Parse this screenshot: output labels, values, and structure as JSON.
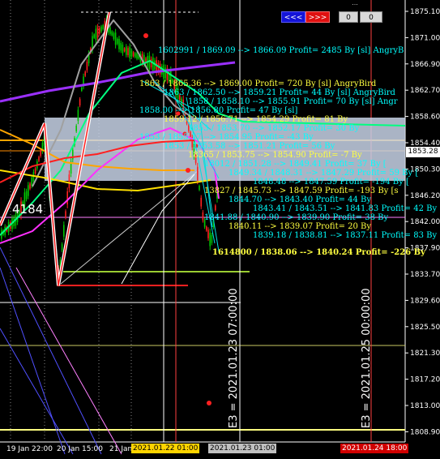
{
  "window": {
    "title": "..."
  },
  "controls": {
    "prev": "<<<",
    "next": ">>>",
    "field_a": "0",
    "field_b": "0"
  },
  "price_axis": {
    "labels": [
      "1875.10",
      "1871.00",
      "1866.90",
      "1862.70",
      "1858.60",
      "1854.40",
      "1850.30",
      "1846.20",
      "1842.00",
      "1837.90",
      "1833.70",
      "1829.60",
      "1825.50",
      "1821.30",
      "1817.20",
      "1813.00",
      "1808.90"
    ],
    "current_price": "1853.28"
  },
  "time_axis": {
    "labels": [
      "19 Jan 22:00",
      "20 Jan 15:00",
      "21 Jan"
    ],
    "highlighted": [
      {
        "text": "2021.01.22 01:00",
        "color": "#ffd400"
      },
      {
        "text": "2021.01.23 01:00",
        "color": "#c0c0c0"
      },
      {
        "text": "2021.01.24 18:00",
        "color": "#d00000"
      }
    ]
  },
  "vertical_markers": [
    {
      "text": "E3 = 2021.01.23 07:00:00"
    },
    {
      "text": "E3 = 2021.01.25 00:00:00"
    }
  ],
  "annotations": {
    "top_trade": "1602991 / 1869.09 --> 1866.09 Profit= 2485 By [sl] AngryB",
    "bottom_trade": "1614800 / 1838.06 --> 1840.24 Profit= -226 By",
    "left_label": "4184",
    "overlap_lines": [
      "1863 / 1865.36 --> 1869.00 Profit= 720 By [sl] AngryBird",
      "1863 / 1862.50 --> 1859.21 Profit= 44 By [sl] AngryBird",
      "1858 / 1858.10 --> 1855.91 Profit= 70 By [sl] Angr",
      "1858.00 --> 1856.80 Profit= 47 By [sl]",
      "1859.12 / 1856.71 --> 1854.29 Profit= 81 By",
      "1853 / 1853.70 --> 1852.17 Profit= 30 By",
      "1853 / 1855.17 --> 1854.95 Profit= -43 By",
      "1853 / 1853.58 --> 1851.21 Profit= 56 By",
      "18365 / 1853.75 --> 1854.90 Profit= -7 By",
      "18012 / 1851.28 --> 1849.41 Profit= 37 By [",
      "1849.34 / 1848.31 --> 1847.29 Profit= 59 By [",
      "1848.48 --> 1847.59 Profit= -194 By [",
      "13827 / 1845.73 --> 1847.59 Profit= -193 By [s",
      "1844.70 --> 1843.40 Profit= 44 By",
      "1843.41 / 1843.51 --> 1841.83 Profit= 42 By",
      "1841.88 / 1840.90 --> 1839.90 Profit= 38 By",
      "1840.11 --> 1839.07 Profit= 20 By",
      "1839.18 / 1838.81 --> 1837.11 Profit= 83 By"
    ]
  },
  "colors": {
    "background": "#000000",
    "bull_candle": "#00c800",
    "zigzag": "#ffffff",
    "ma_purple": "#9b30ff",
    "ma_orange": "#ffa500",
    "ma_yellow": "#ffe000",
    "ma_green": "#00ff80",
    "ma_magenta": "#ff30ff",
    "ma_red": "#ff2020",
    "zone": "#c8d4e8",
    "cyan_text": "#00ffff",
    "yellow_text": "#ffff40"
  }
}
